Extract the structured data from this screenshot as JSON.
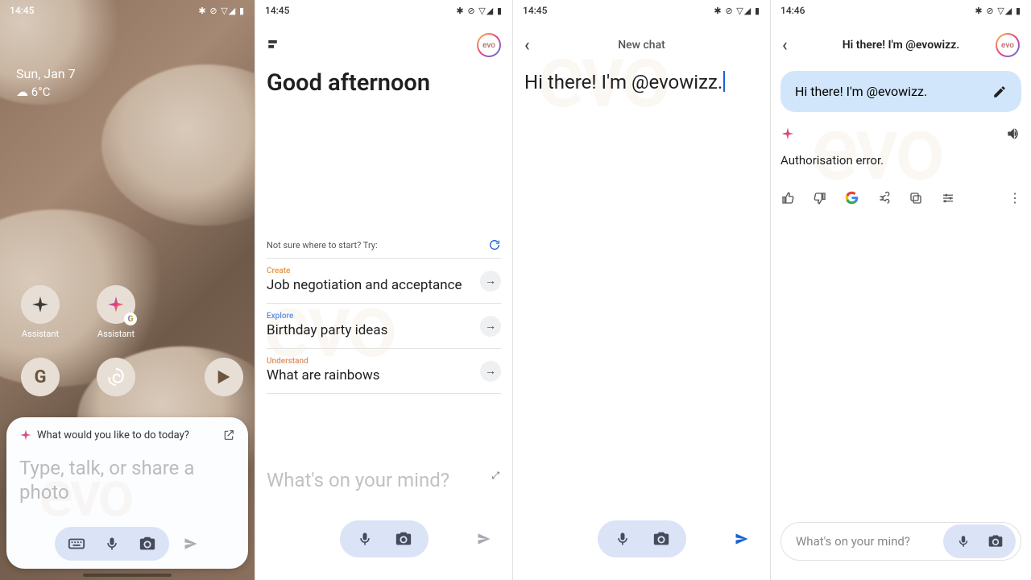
{
  "panel1": {
    "time": "14:45",
    "status_icons": "✱ ⊘ ▽◢ ▮",
    "date": "Sun, Jan 7",
    "weather_icon": "☁",
    "temp": "6°C",
    "apps": [
      {
        "label": "Assistant",
        "icon": "spark-dark"
      },
      {
        "label": "Assistant",
        "icon": "spark-color",
        "badge": "G"
      }
    ],
    "dock": [
      {
        "icon": "google-g"
      },
      {
        "icon": "threads"
      },
      {
        "icon": "play"
      }
    ],
    "card": {
      "prompt_label": "What would you like to do today?",
      "placeholder": "Type, talk, or share a photo"
    }
  },
  "panel2": {
    "time": "14:45",
    "status_icons": "✱ ⊘ ▽◢ ▮",
    "avatar_text": "evo",
    "greeting": "Good afternoon",
    "suggest_header": "Not sure where to start? Try:",
    "suggestions": [
      {
        "tag": "Create",
        "tag_class": "tag-create",
        "text": "Job negotiation and acceptance"
      },
      {
        "tag": "Explore",
        "tag_class": "tag-explore",
        "text": "Birthday party ideas"
      },
      {
        "tag": "Understand",
        "tag_class": "tag-understand",
        "text": "What are rainbows"
      }
    ],
    "input_placeholder": "What's on your mind?"
  },
  "panel3": {
    "time": "14:45",
    "status_icons": "✱ ⊘ ▽◢ ▮",
    "title": "New chat",
    "typed": "Hi there! I'm @evowizz."
  },
  "panel4": {
    "time": "14:46",
    "status_icons": "✱ ⊘ ▽◢ ▮",
    "title": "Hi there! I'm @evowizz.",
    "avatar_text": "evo",
    "user_msg": "Hi there! I'm @evowizz.",
    "reply": "Authorisation error.",
    "input_placeholder": "What's on your mind?"
  }
}
